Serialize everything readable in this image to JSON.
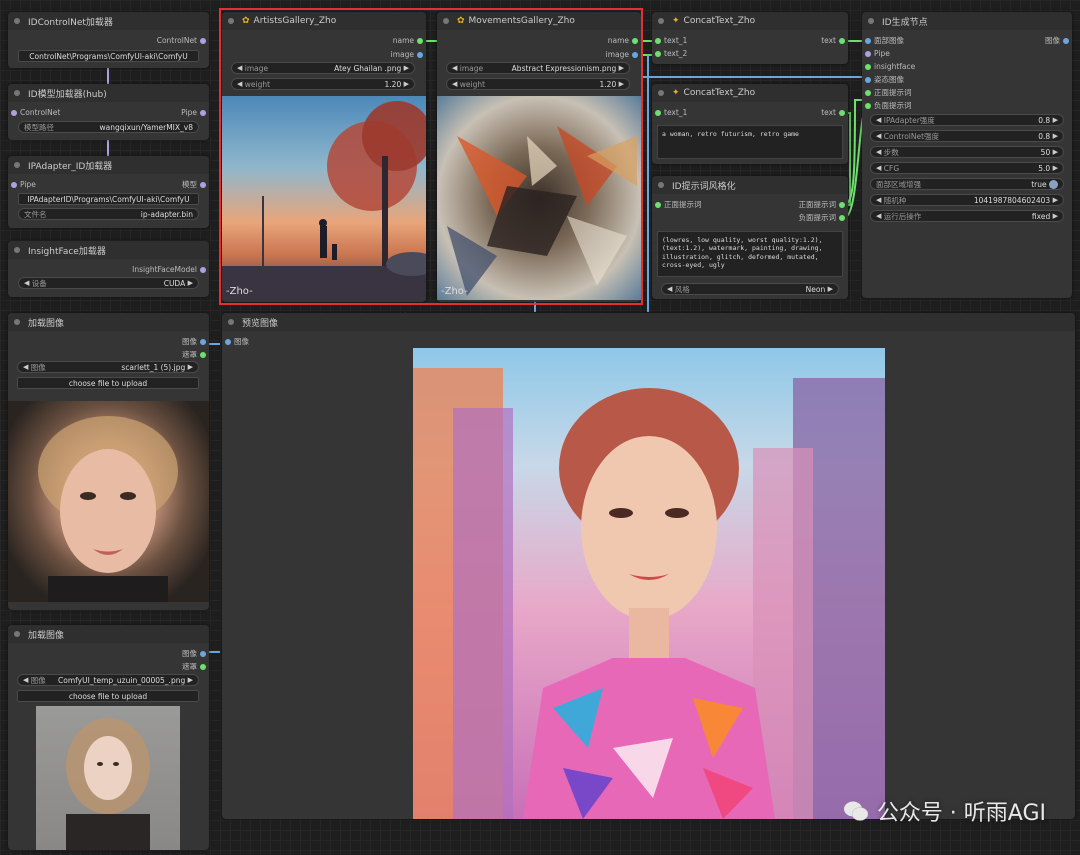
{
  "nodes": {
    "idcontrolnet": {
      "title": "IDControlNet加载器",
      "out": "ControlNet",
      "path": "ControlNet\\Programs\\ComfyUI-aki\\ComfyU"
    },
    "idmodel": {
      "title": "ID模型加载器(hub)",
      "in": "ControlNet",
      "out": "Pipe",
      "label": "模型路径",
      "value": "wangqixun/YamerMIX_v8"
    },
    "ipadapter": {
      "title": "IPAdapter_ID加载器",
      "in": "Pipe",
      "out": "模型",
      "path": "IPAdapterID\\Programs\\ComfyUI-aki\\ComfyU",
      "file_label": "文件名",
      "file_value": "ip-adapter.bin"
    },
    "insightface": {
      "title": "InsightFace加载器",
      "out": "InsightFaceModel",
      "label": "设备",
      "value": "CUDA"
    },
    "artists": {
      "title": "ArtistsGallery_Zho",
      "out1": "name",
      "out2": "image",
      "image_label": "image",
      "image_value": "Atey Ghailan .png",
      "weight_label": "weight",
      "weight_value": "1.20",
      "caption": "-Zho-"
    },
    "movements": {
      "title": "MovementsGallery_Zho",
      "out1": "name",
      "out2": "image",
      "image_label": "image",
      "image_value": "Abstract Expressionism.png",
      "weight_label": "weight",
      "weight_value": "1.20",
      "caption": "-Zho-"
    },
    "concat1": {
      "title": "ConcatText_Zho",
      "in1": "text_1",
      "in2": "text_2",
      "out": "text"
    },
    "concat2": {
      "title": "ConcatText_Zho",
      "in1": "text_1",
      "out": "text",
      "text": "a woman, retro futurism, retro game"
    },
    "idstyle": {
      "title": "ID提示词风格化",
      "in": "正面提示词",
      "out1": "正面提示词",
      "out2": "负面提示词",
      "text": "(lowres, low quality, worst quality:1.2),\n(text:1.2), watermark, painting, drawing,\nillustration, glitch, deformed, mutated,\ncross-eyed, ugly",
      "style_label": "风格",
      "style_value": "Neon"
    },
    "idgen": {
      "title": "ID生成节点",
      "inputs": [
        "面部图像",
        "Pipe",
        "insightface",
        "姿态图像",
        "正面提示词",
        "负面提示词"
      ],
      "out": "图像",
      "widgets": [
        {
          "label": "IPAdapter强度",
          "value": "0.8"
        },
        {
          "label": "ControlNet强度",
          "value": "0.8"
        },
        {
          "label": "步数",
          "value": "50"
        },
        {
          "label": "CFG",
          "value": "5.0"
        },
        {
          "label": "面部区域增强",
          "value": "true"
        },
        {
          "label": "随机种",
          "value": "1041987804602403"
        },
        {
          "label": "运行后操作",
          "value": "fixed"
        }
      ]
    },
    "load1": {
      "title": "加载图像",
      "out1": "图像",
      "out2": "遮罩",
      "label": "图像",
      "value": "scarlett_1 (5).jpg",
      "upload": "choose file to upload"
    },
    "load2": {
      "title": "加载图像",
      "out1": "图像",
      "out2": "遮罩",
      "label": "图像",
      "value": "ComfyUI_temp_uzuin_00005_.png",
      "upload": "choose file to upload"
    },
    "preview": {
      "title": "预览图像",
      "in": "图像"
    }
  },
  "watermark": "公众号 · 听雨AGI",
  "colors": {
    "highlight": "#e53030",
    "link_blue": "#6aa7e0",
    "link_green": "#6ee06e",
    "link_purple": "#b0a0e0"
  }
}
